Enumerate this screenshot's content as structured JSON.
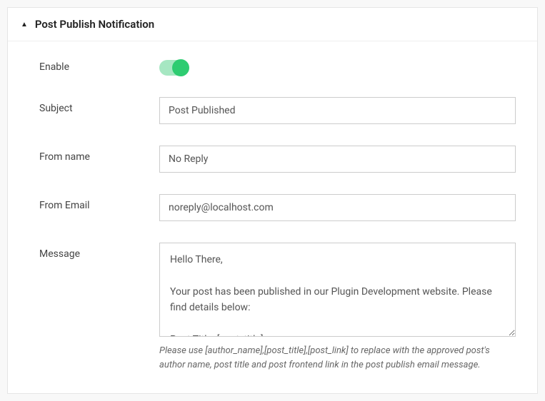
{
  "section": {
    "title": "Post Publish Notification"
  },
  "fields": {
    "enable": {
      "label": "Enable",
      "value": true
    },
    "subject": {
      "label": "Subject",
      "value": "Post Published"
    },
    "from_name": {
      "label": "From name",
      "value": "No Reply"
    },
    "from_email": {
      "label": "From Email",
      "value": "noreply@localhost.com"
    },
    "message": {
      "label": "Message",
      "value": "Hello There,\n\nYour post has been published in our Plugin Development website. Please find details below:\n\nPost Title: [post_title]",
      "help": "Please use [author_name],[post_title],[post_link] to replace with the approved post's author name, post title and post frontend link in the post publish email message."
    }
  }
}
